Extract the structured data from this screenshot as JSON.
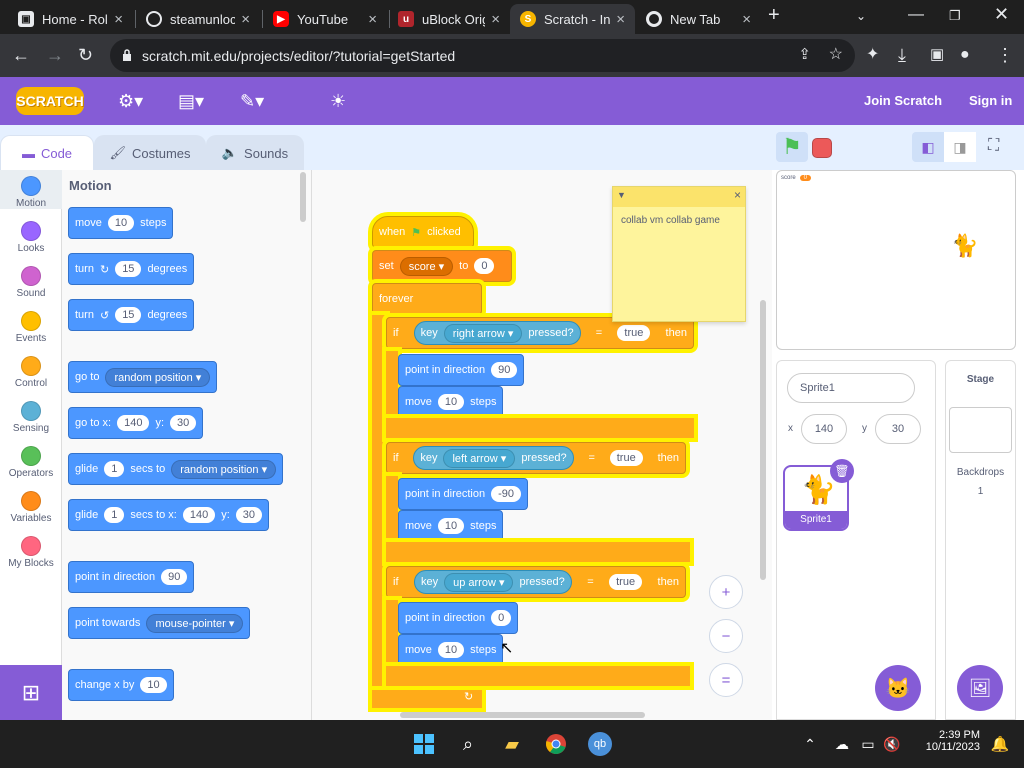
{
  "browser": {
    "tabs": [
      {
        "title": "Home - Rol",
        "favicon": "roblox-icon",
        "fav_color": "#e8eaed"
      },
      {
        "title": "steamunloc",
        "favicon": "globe-icon",
        "fav_color": "#e8eaed"
      },
      {
        "title": "YouTube",
        "favicon": "youtube-icon",
        "fav_color": "#ff0000"
      },
      {
        "title": "uBlock Orig",
        "favicon": "ublock-icon",
        "fav_color": "#b0252c"
      },
      {
        "title": "Scratch - In",
        "favicon": "scratch-icon",
        "fav_color": "#f7b500"
      },
      {
        "title": "New Tab",
        "favicon": "chrome-icon",
        "fav_color": "#e8eaed"
      }
    ],
    "url": "scratch.mit.edu/projects/editor/?tutorial=getStarted"
  },
  "menubar": {
    "logo": "SCRATCH",
    "join": "Join Scratch",
    "signin": "Sign in",
    "color": "#855cd6"
  },
  "editor_tabs": {
    "code": "Code",
    "costumes": "Costumes",
    "sounds": "Sounds"
  },
  "categories": [
    {
      "label": "Motion",
      "color": "#4c97ff"
    },
    {
      "label": "Looks",
      "color": "#9966ff"
    },
    {
      "label": "Sound",
      "color": "#cf63cf"
    },
    {
      "label": "Events",
      "color": "#ffbf00"
    },
    {
      "label": "Control",
      "color": "#ffab19"
    },
    {
      "label": "Sensing",
      "color": "#5cb1d6"
    },
    {
      "label": "Operators",
      "color": "#59c059"
    },
    {
      "label": "Variables",
      "color": "#ff8c1a"
    },
    {
      "label": "My Blocks",
      "color": "#ff6680"
    }
  ],
  "palette": {
    "heading": "Motion",
    "move": {
      "a": "move",
      "v": "10",
      "b": "steps"
    },
    "turn_right": {
      "a": "turn",
      "v": "15",
      "b": "degrees"
    },
    "turn_left": {
      "a": "turn",
      "v": "15",
      "b": "degrees"
    },
    "goto": {
      "a": "go to",
      "d": "random position"
    },
    "gotoxy": {
      "a": "go to x:",
      "x": "140",
      "b": "y:",
      "y": "30"
    },
    "glide_to": {
      "a": "glide",
      "v": "1",
      "b": "secs to",
      "d": "random position"
    },
    "glide_xy": {
      "a": "glide",
      "v": "1",
      "b": "secs to x:",
      "x": "140",
      "c": "y:",
      "y": "30"
    },
    "point_dir": {
      "a": "point in direction",
      "v": "90"
    },
    "point_towards": {
      "a": "point towards",
      "d": "mouse-pointer"
    },
    "change_x": {
      "a": "change x by",
      "v": "10"
    }
  },
  "script": {
    "hat": {
      "a": "when",
      "b": "clicked"
    },
    "set": {
      "a": "set",
      "var": "score",
      "b": "to",
      "v": "0"
    },
    "forever": "forever",
    "if_label": "if",
    "then_label": "then",
    "key_label": "key",
    "pressed_label": "pressed?",
    "eq": "=",
    "true_val": "true",
    "point_label": "point in direction",
    "move_a": "move",
    "move_b": "steps",
    "ifs": [
      {
        "key": "right arrow",
        "dir": "90",
        "steps": "10"
      },
      {
        "key": "left arrow",
        "dir": "-90",
        "steps": "10"
      },
      {
        "key": "up arrow",
        "dir": "0",
        "steps": "10"
      }
    ]
  },
  "note": {
    "text": "collab vm collab game"
  },
  "zoom": {
    "in": "+",
    "out": "−",
    "reset": "="
  },
  "stage": {
    "monitor_label": "score",
    "monitor_value": "0"
  },
  "sprite": {
    "name_value": "Sprite1",
    "x_label": "x",
    "x": "140",
    "y_label": "y",
    "y": "30",
    "thumb_label": "Sprite1"
  },
  "stage_pane": {
    "title": "Stage",
    "backdrops_label": "Backdrops",
    "backdrops_count": "1"
  },
  "taskbar": {
    "time": "2:39 PM",
    "date": "10/11/2023"
  }
}
